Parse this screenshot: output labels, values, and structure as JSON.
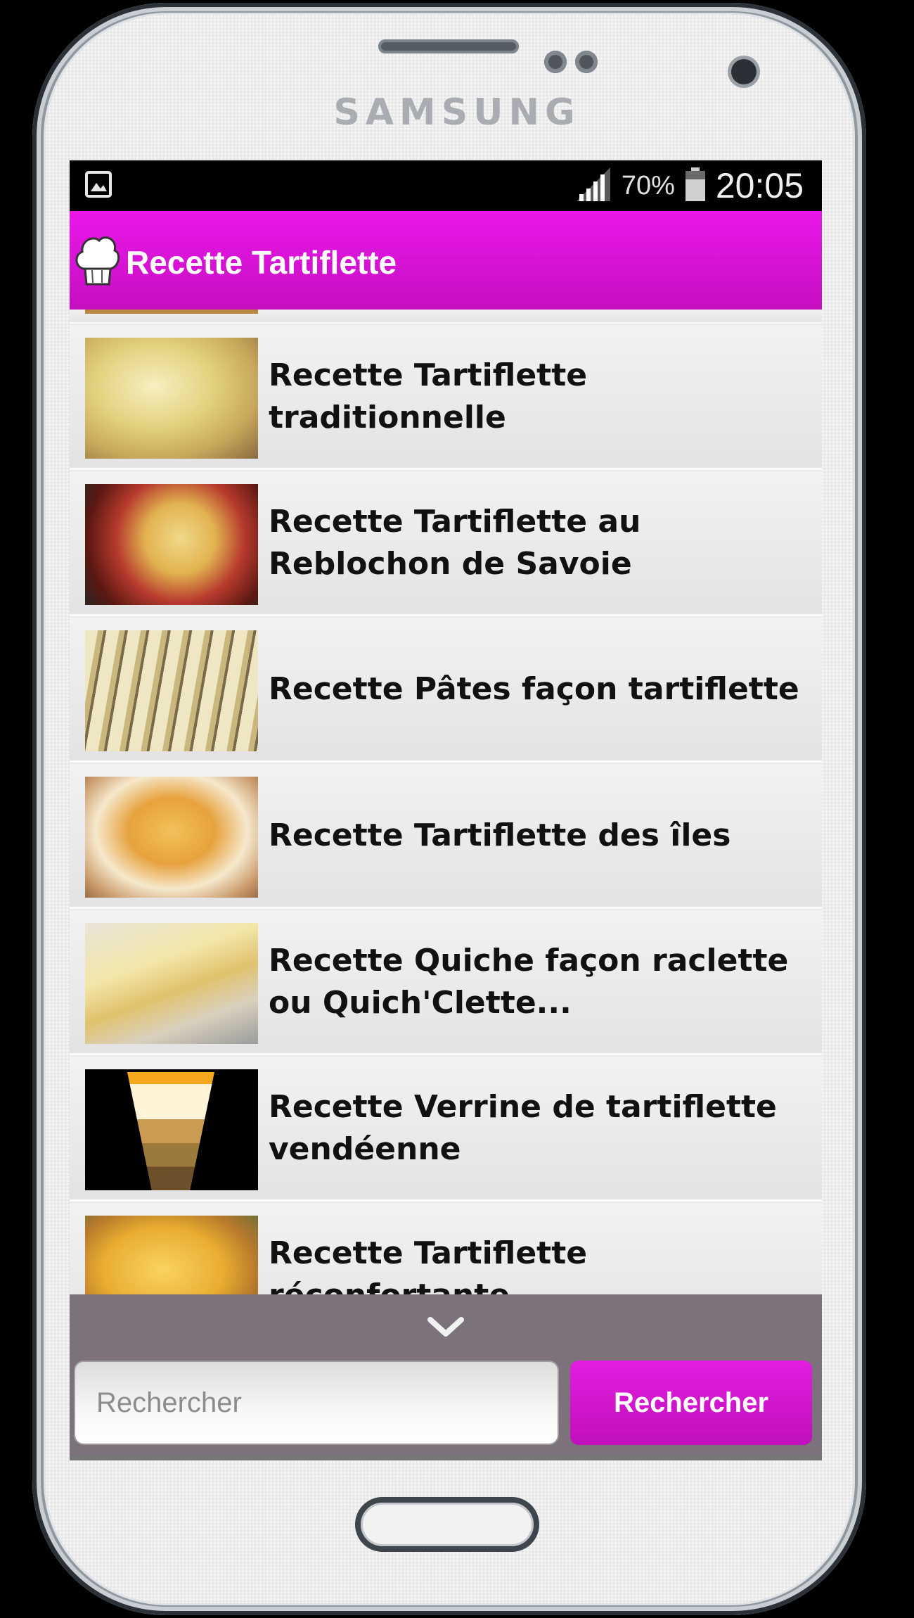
{
  "device": {
    "brand": "SAMSUNG"
  },
  "status_bar": {
    "notification_icon": "image-icon",
    "signal_icon": "signal-icon",
    "battery_percent": "70%",
    "battery_icon": "battery-icon",
    "time": "20:05"
  },
  "app_bar": {
    "icon": "chef-hat-icon",
    "title": "Recette Tartiflette",
    "color": "#e314e0"
  },
  "recipes": [
    {
      "title": "Recette Tartiflette traditionnelle"
    },
    {
      "title": "Recette Tartiflette au Reblochon de Savoie"
    },
    {
      "title": "Recette Pâtes façon tartiflette"
    },
    {
      "title": "Recette Tartiflette des îles"
    },
    {
      "title": "Recette Quiche façon raclette ou Quich'Clette..."
    },
    {
      "title": "Recette Verrine de tartiflette vendéenne"
    },
    {
      "title": "Recette Tartiflette réconfortante"
    }
  ],
  "search": {
    "collapse_icon": "chevron-down-icon",
    "placeholder": "Rechercher",
    "button_label": "Rechercher"
  }
}
